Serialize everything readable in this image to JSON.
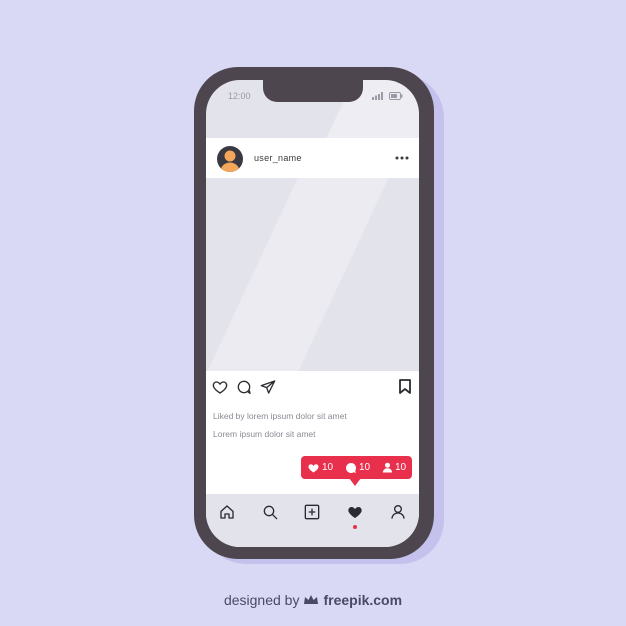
{
  "status_bar": {
    "time": "12:00"
  },
  "post": {
    "username": "user_name",
    "liked_by": "Liked by lorem ipsum dolor sit amet",
    "caption": "Lorem ipsum dolor sit amet"
  },
  "notification": {
    "likes": "10",
    "comments": "10",
    "followers": "10"
  },
  "bottom_nav": {
    "items": [
      "home-icon",
      "search-icon",
      "add-post-icon",
      "heart-icon",
      "profile-icon"
    ],
    "active": "heart-icon"
  },
  "credit": {
    "prefix": "designed by",
    "brand": "freepik.com"
  },
  "colors": {
    "background": "#d9d8f5",
    "phone_body": "#4d464f",
    "accent": "#e8304c",
    "avatar_skin": "#f4a75a"
  }
}
